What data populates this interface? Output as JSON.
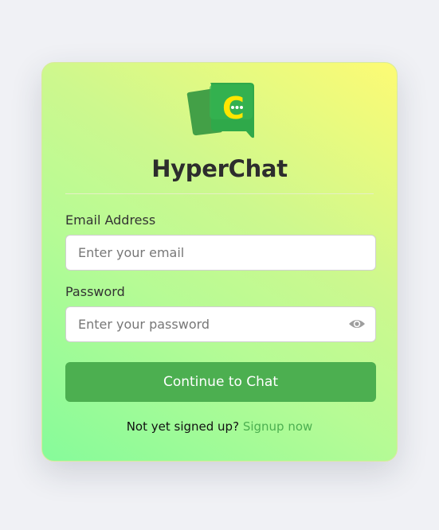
{
  "brand": {
    "name": "HyperChat",
    "logo_letter": "C",
    "logo_icon": "chat-bubble-logo-icon"
  },
  "form": {
    "email_label": "Email Address",
    "email_placeholder": "Enter your email",
    "password_label": "Password",
    "password_placeholder": "Enter your password",
    "password_toggle_icon": "eye-icon",
    "submit_label": "Continue to Chat"
  },
  "signup": {
    "prompt": "Not yet signed up?",
    "link_label": "Signup now"
  },
  "colors": {
    "accent": "#4caf50",
    "logo_yellow": "#ffe600",
    "text": "#2d2d2d"
  }
}
